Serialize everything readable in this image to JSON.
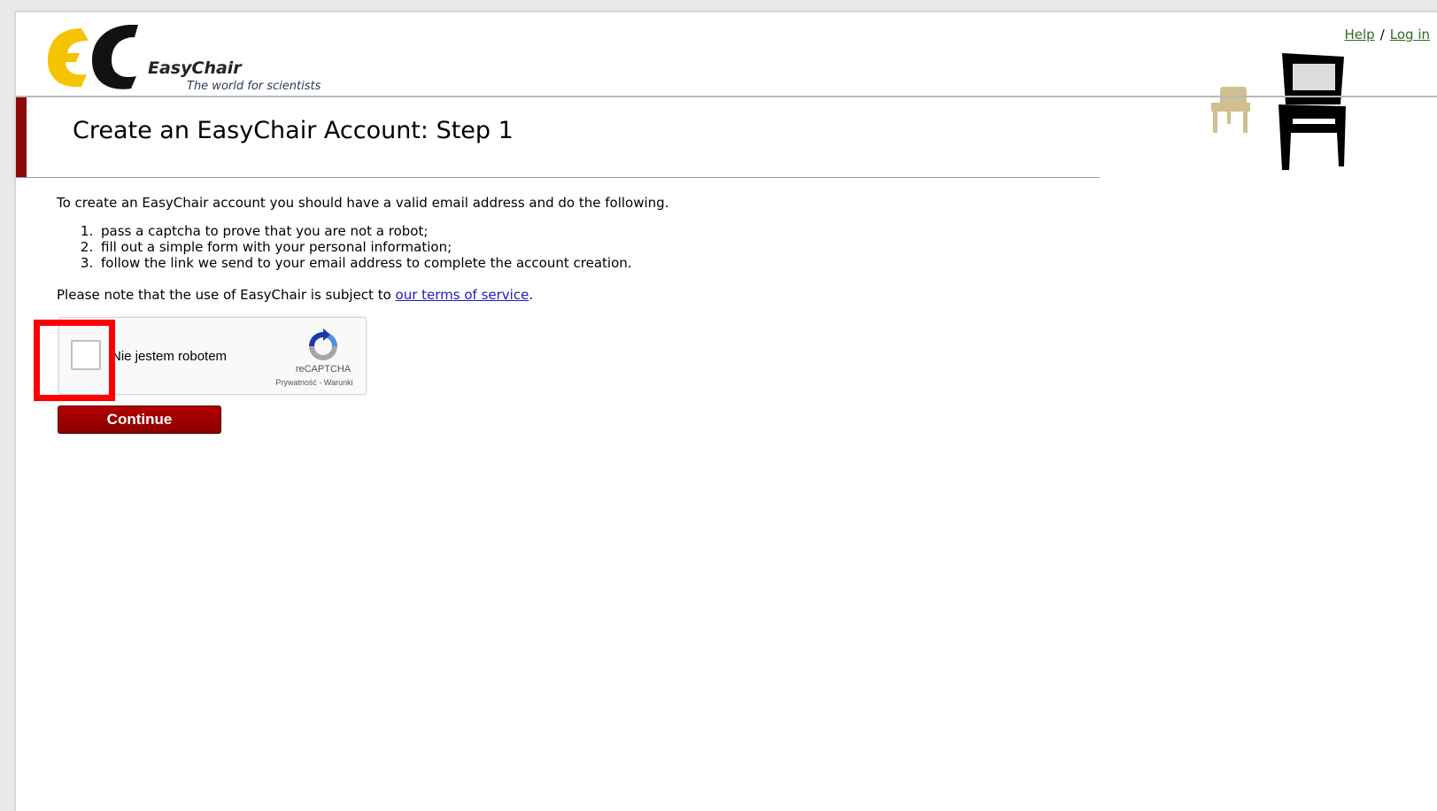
{
  "header": {
    "logo_word": "EasyChair",
    "logo_tagline": "The world for scientists",
    "links": {
      "help": "Help",
      "separator": "/",
      "login": "Log in"
    }
  },
  "page": {
    "title": "Create an EasyChair Account: Step 1",
    "intro": "To create an EasyChair account you should have a valid email address and do the following.",
    "steps": [
      "pass a captcha to prove that you are not a robot;",
      "fill out a simple form with your personal information;",
      "follow the link we send to your email address to complete the account creation."
    ],
    "note_prefix": "Please note that the use of EasyChair is subject to ",
    "note_link": "our terms of service",
    "note_suffix": "."
  },
  "recaptcha": {
    "checkbox_label": "Nie jestem robotem",
    "brand": "reCAPTCHA",
    "privacy": "Prywatność",
    "dash": " - ",
    "terms": "Warunki",
    "checked": false
  },
  "form": {
    "continue_label": "Continue"
  },
  "colors": {
    "accent_red": "#8b0a0a",
    "link_green": "#2e6b1e",
    "link_blue": "#1a1acc",
    "highlight": "#ff0000",
    "logo_yellow": "#f5c400"
  }
}
